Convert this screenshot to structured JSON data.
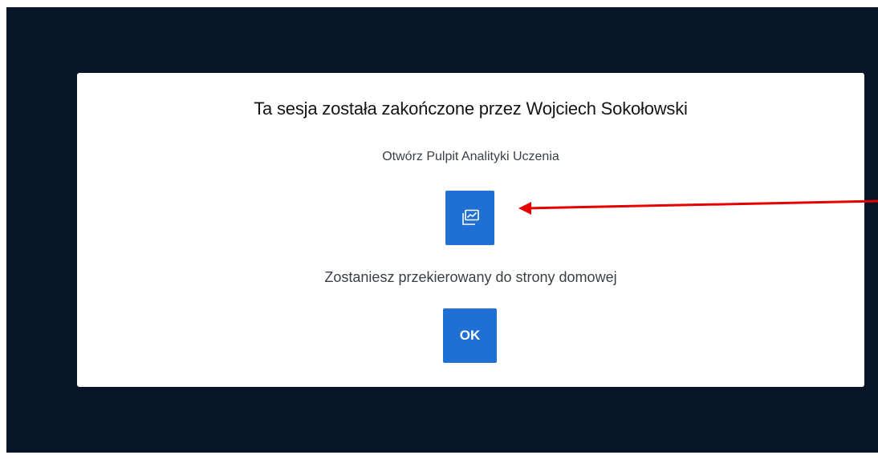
{
  "dialog": {
    "title": "Ta sesja została zakończone przez Wojciech Sokołowski",
    "dashboard_label": "Otwórz Pulpit Analityki Uczenia",
    "dashboard_icon": "analytics-dashboard-icon",
    "redirect_text": "Zostaniesz przekierowany do strony domowej",
    "ok_label": "OK"
  },
  "colors": {
    "backdrop": "#061628",
    "button": "#1f6fd4",
    "annotation_arrow": "#e60000"
  }
}
